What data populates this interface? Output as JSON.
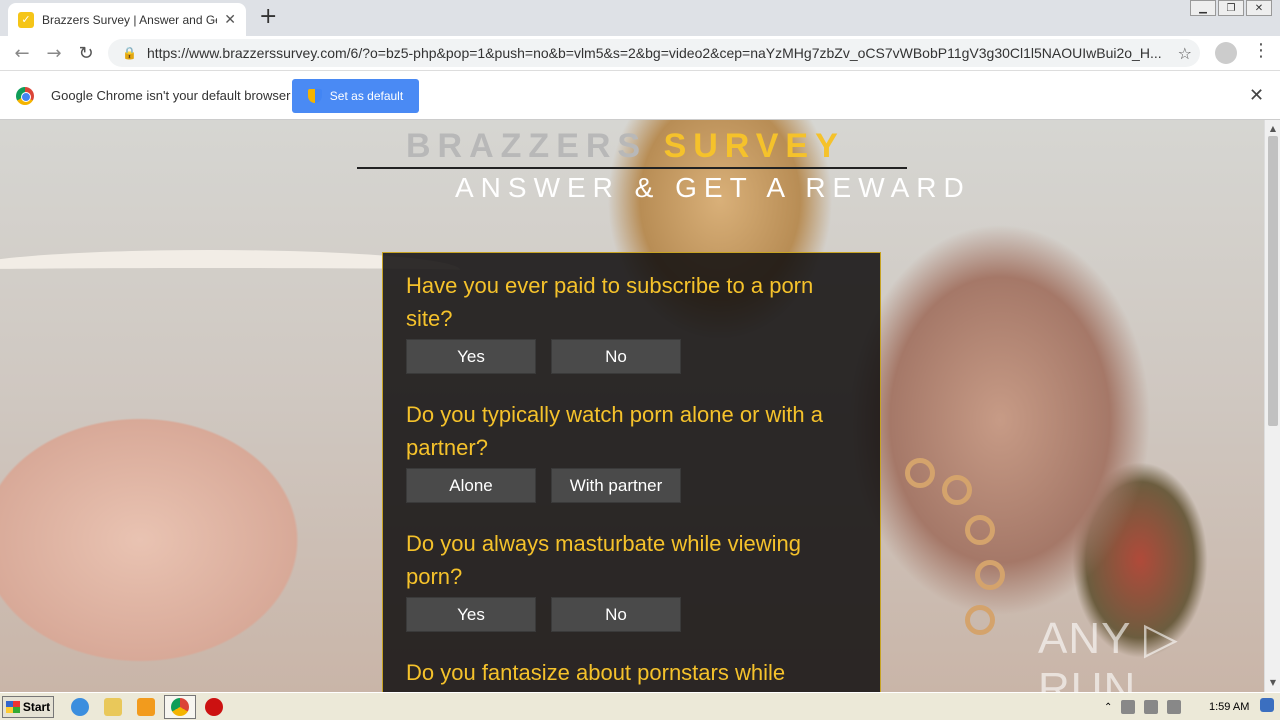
{
  "browser": {
    "tab_title": "Brazzers Survey | Answer and Get a",
    "url": "https://www.brazzerssurvey.com/6/?o=bz5-php&pop=1&push=no&b=vlm5&s=2&bg=video2&cep=naYzMHg7zbZv_oCS7vWBobP11gV3g30Cl1l5NAOUIwBui2o_H...",
    "infobar_text": "Google Chrome isn't your default browser",
    "set_default_label": "Set as default"
  },
  "page": {
    "logo_left": "BRAZZERS",
    "logo_right": "SURVEY",
    "subtitle": "ANSWER & GET A REWARD",
    "questions": [
      {
        "text": "Have you ever paid to subscribe to a porn site?",
        "answers": [
          "Yes",
          "No"
        ]
      },
      {
        "text": "Do you typically watch porn alone or with a partner?",
        "answers": [
          "Alone",
          "With partner"
        ]
      },
      {
        "text": "Do you always masturbate while viewing porn?",
        "answers": [
          "Yes",
          "No"
        ]
      },
      {
        "text": "Do you fantasize about pornstars while",
        "answers": []
      }
    ],
    "watermark": "ANY ▷ RUN"
  },
  "taskbar": {
    "start_label": "Start",
    "clock": "1:59 AM"
  },
  "colors": {
    "accent": "#f5c22b",
    "button": "#4a4a4a"
  },
  "icons": {
    "back": "back-arrow-icon",
    "forward": "forward-arrow-icon",
    "reload": "reload-icon",
    "lock": "lock-icon",
    "bookmark": "star-icon",
    "profile": "profile-icon",
    "menu": "kebab-menu-icon"
  }
}
